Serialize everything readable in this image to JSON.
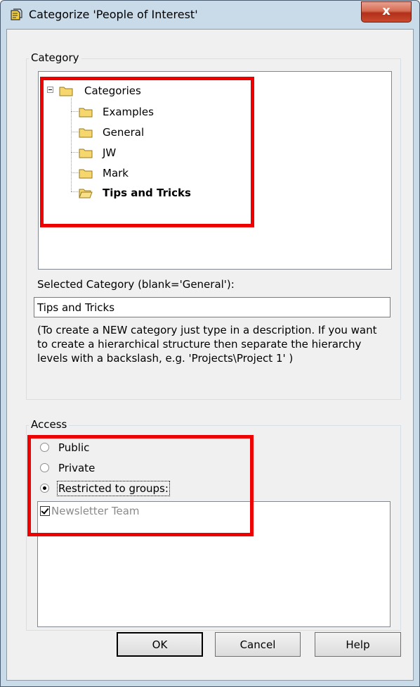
{
  "window": {
    "title": "Categorize 'People of Interest'",
    "close_label": "x",
    "icon": "category-app-icon"
  },
  "category": {
    "group_label": "Category",
    "tree": {
      "root": "Categories",
      "children": [
        "Examples",
        "General",
        "JW",
        "Mark",
        "Tips and Tricks"
      ],
      "selected": "Tips and Tricks"
    },
    "selected_label": "Selected Category (blank='General'):",
    "selected_value": "Tips and Tricks",
    "help_text": "(To create a NEW category just type in a description. If you want to create a hierarchical structure then separate the hierarchy levels with a backslash, e.g. 'Projects\\Project 1' )"
  },
  "access": {
    "group_label": "Access",
    "options": [
      "Public",
      "Private",
      "Restricted to groups:"
    ],
    "selected": "Restricted to groups:",
    "groups": [
      {
        "label": "Newsletter Team",
        "checked": true
      }
    ]
  },
  "buttons": {
    "ok": "OK",
    "cancel": "Cancel",
    "help": "Help"
  },
  "colors": {
    "highlight": "#ee0000",
    "frame": "#c9dae9",
    "close_button": "#c94a2e"
  }
}
